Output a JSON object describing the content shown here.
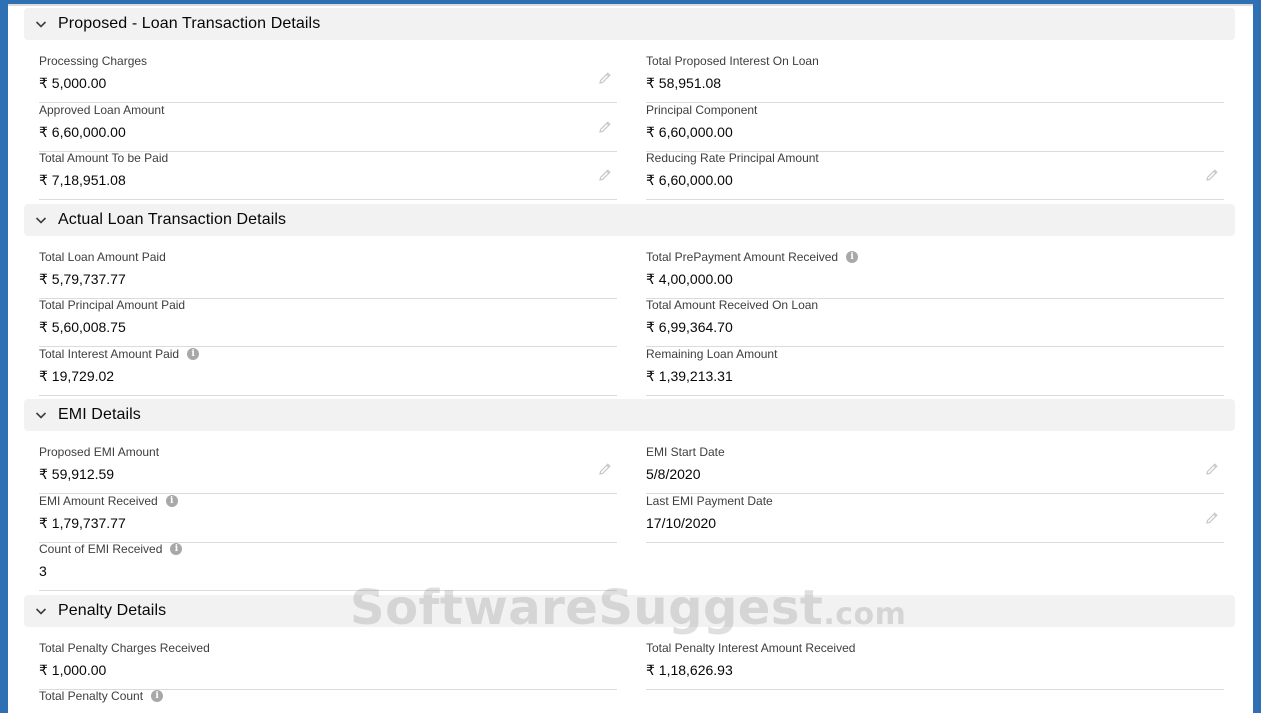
{
  "sections": [
    {
      "title": "Proposed - Loan Transaction Details",
      "fields": [
        {
          "label": "Processing Charges",
          "value": "₹ 5,000.00"
        },
        {
          "label": "Total Proposed Interest On Loan",
          "value": "₹ 58,951.08"
        },
        {
          "label": "Approved Loan Amount",
          "value": "₹ 6,60,000.00"
        },
        {
          "label": "Principal Component",
          "value": "₹ 6,60,000.00"
        },
        {
          "label": "Total Amount To be Paid",
          "value": "₹ 7,18,951.08"
        },
        {
          "label": "Reducing Rate Principal Amount",
          "value": "₹ 6,60,000.00"
        }
      ]
    },
    {
      "title": "Actual Loan Transaction Details",
      "fields": [
        {
          "label": "Total Loan Amount Paid",
          "value": "₹ 5,79,737.77"
        },
        {
          "label": "Total PrePayment Amount Received",
          "value": "₹ 4,00,000.00"
        },
        {
          "label": "Total Principal Amount Paid",
          "value": "₹ 5,60,008.75"
        },
        {
          "label": "Total Amount Received On Loan",
          "value": "₹ 6,99,364.70"
        },
        {
          "label": "Total Interest Amount Paid",
          "value": "₹ 19,729.02"
        },
        {
          "label": "Remaining Loan Amount",
          "value": "₹ 1,39,213.31"
        }
      ]
    },
    {
      "title": "EMI Details",
      "fields": [
        {
          "label": "Proposed EMI Amount",
          "value": "₹ 59,912.59"
        },
        {
          "label": "EMI Start Date",
          "value": "5/8/2020"
        },
        {
          "label": "EMI Amount Received",
          "value": "₹ 1,79,737.77"
        },
        {
          "label": "Last EMI Payment Date",
          "value": "17/10/2020"
        },
        {
          "label": "Count of EMI Received",
          "value": "3"
        }
      ]
    },
    {
      "title": "Penalty Details",
      "fields": [
        {
          "label": "Total Penalty Charges Received",
          "value": "₹ 1,000.00"
        },
        {
          "label": "Total Penalty Interest Amount Received",
          "value": "₹ 1,18,626.93"
        },
        {
          "label": "Total Penalty Count",
          "value": ""
        }
      ]
    }
  ],
  "watermark": {
    "main": "SoftwareSuggest",
    "suffix": ".com"
  },
  "icons": {
    "chevron": "chevron-down-icon",
    "edit": "pencil-icon",
    "info": "info-icon"
  },
  "colors": {
    "header_bg": "#f3f2f2",
    "divider": "#dddbda",
    "label": "#3e3e3c",
    "frame": "#2f6fb3"
  }
}
